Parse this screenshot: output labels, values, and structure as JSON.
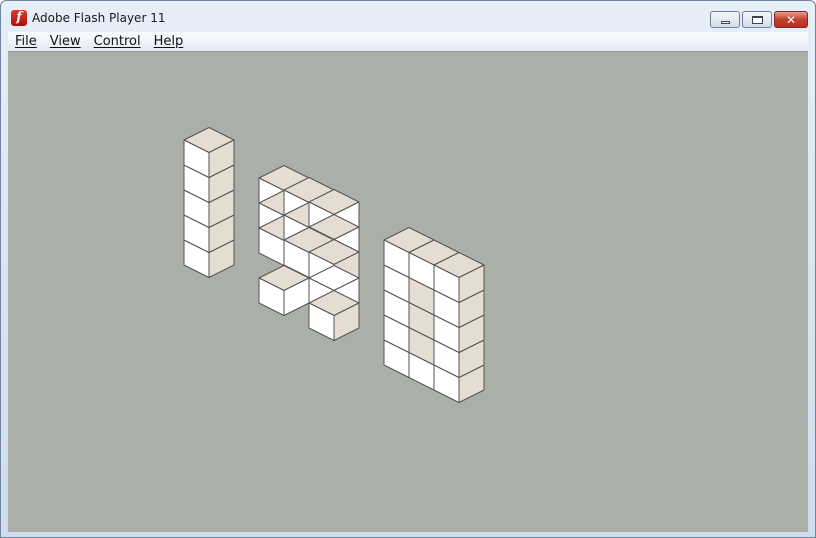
{
  "window": {
    "title": "Adobe Flash Player 11",
    "app_icon": "flash-player-icon",
    "controls": {
      "minimize": "minimize-icon",
      "maximize": "maximize-icon",
      "close": "close-icon",
      "close_glyph": "✕"
    }
  },
  "menu": {
    "items": [
      {
        "label": "File"
      },
      {
        "label": "View"
      },
      {
        "label": "Control"
      },
      {
        "label": "Help"
      }
    ]
  },
  "stage": {
    "background": "#aab0a8",
    "content": "isometric cube digits",
    "colors": {
      "face_white": "#ffffff",
      "face_shaded": "#e5dcd2",
      "outline": "#555555"
    }
  }
}
